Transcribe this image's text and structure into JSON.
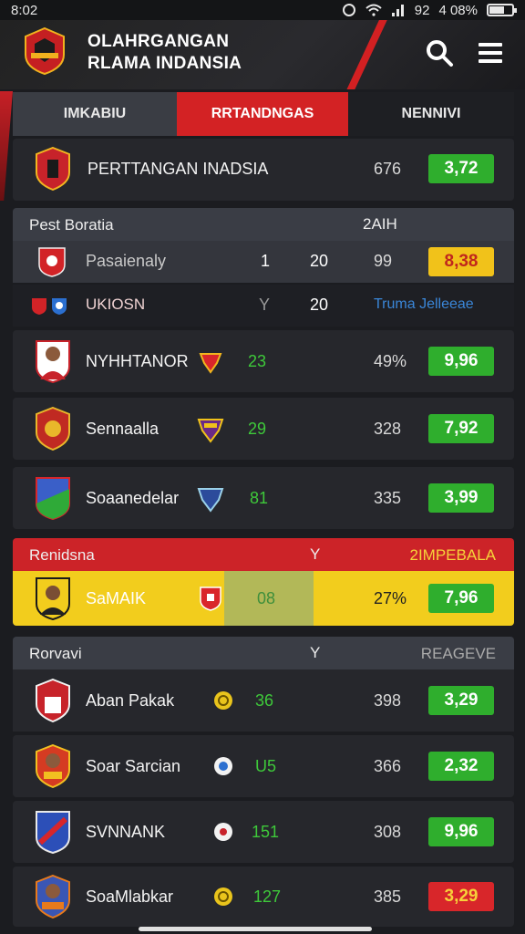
{
  "status": {
    "time": "8:02",
    "signal_text": "92",
    "battery": "4 08%"
  },
  "header": {
    "title_line1": "OLAHRGANGAN",
    "title_line2": "RLAMA INDANSIA"
  },
  "tabs": [
    "IMKABIU",
    "RRTANDNGAS",
    "NENNIVI"
  ],
  "featured": {
    "team": "PERTTANGAN INADSIA",
    "count": "676",
    "odds": "3,72"
  },
  "section1": {
    "header": "Pest Boratia",
    "header_right": "2AIH",
    "row_a": {
      "team": "Pasaienaly",
      "n1": "1",
      "n2": "20",
      "n3": "99",
      "odds": "8,38"
    },
    "row_b": {
      "team": "UKIOSN",
      "n1": "Y",
      "n2": "20",
      "extra": "Truma Jelleeae"
    }
  },
  "matches1": [
    {
      "team": "NYHHTANOR",
      "score": "23",
      "num": "49%",
      "odds": "9,96"
    },
    {
      "team": "Sennaalla",
      "score": "29",
      "num": "328",
      "odds": "7,92"
    },
    {
      "team": "Soaanedelar",
      "score": "81",
      "num": "335",
      "odds": "3,99"
    }
  ],
  "section2": {
    "header": "Renidsna",
    "mid": "Y",
    "right": "2IMPEBALA",
    "row": {
      "team": "SaMAIK",
      "score": "08",
      "num": "27%",
      "odds": "7,96"
    }
  },
  "section3": {
    "header": "Rorvavi",
    "mid": "Y",
    "right": "REAGEVE"
  },
  "matches2": [
    {
      "team": "Aban Pakak",
      "score": "36",
      "num": "398",
      "odds": "3,29"
    },
    {
      "team": "Soar Sarcian",
      "score": "U5",
      "num": "366",
      "odds": "2,32"
    },
    {
      "team": "SVNNANK",
      "score": "151",
      "num": "308",
      "odds": "9,96"
    },
    {
      "team": "SoaMlabkar",
      "score": "127",
      "num": "385",
      "odds": "3,29"
    }
  ],
  "colors": {
    "accent": "#d32224",
    "green": "#2fae2d",
    "yellow": "#f1c21a"
  }
}
